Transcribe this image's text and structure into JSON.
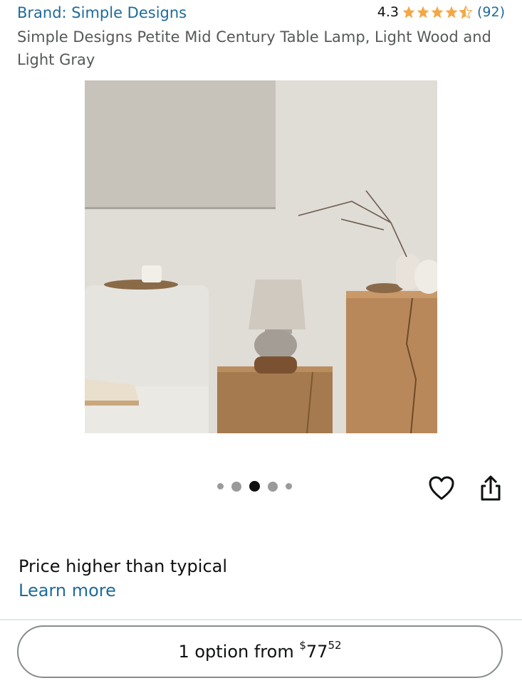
{
  "brand": {
    "label": "Brand: Simple Designs"
  },
  "rating": {
    "value": "4.3",
    "stars": 4.3,
    "count": "(92)",
    "star_color": "#f3a847"
  },
  "product": {
    "title": "Simple Designs Petite Mid Century Table Lamp, Light Wood and Light Gray"
  },
  "gallery": {
    "image_alt": "Lamp on wooden pedestal in living room scene",
    "dots_count": 5,
    "active_dot": 3
  },
  "actions": {
    "wishlist_icon": "heart-icon",
    "share_icon": "share-icon"
  },
  "price_info": {
    "note": "Price higher than typical",
    "link": "Learn more"
  },
  "options": {
    "prefix": "1 option from ",
    "currency": "$",
    "whole": "77",
    "fraction": "52"
  },
  "colors": {
    "link": "#1f6b9a",
    "text": "#0f1111",
    "muted": "#565959"
  }
}
